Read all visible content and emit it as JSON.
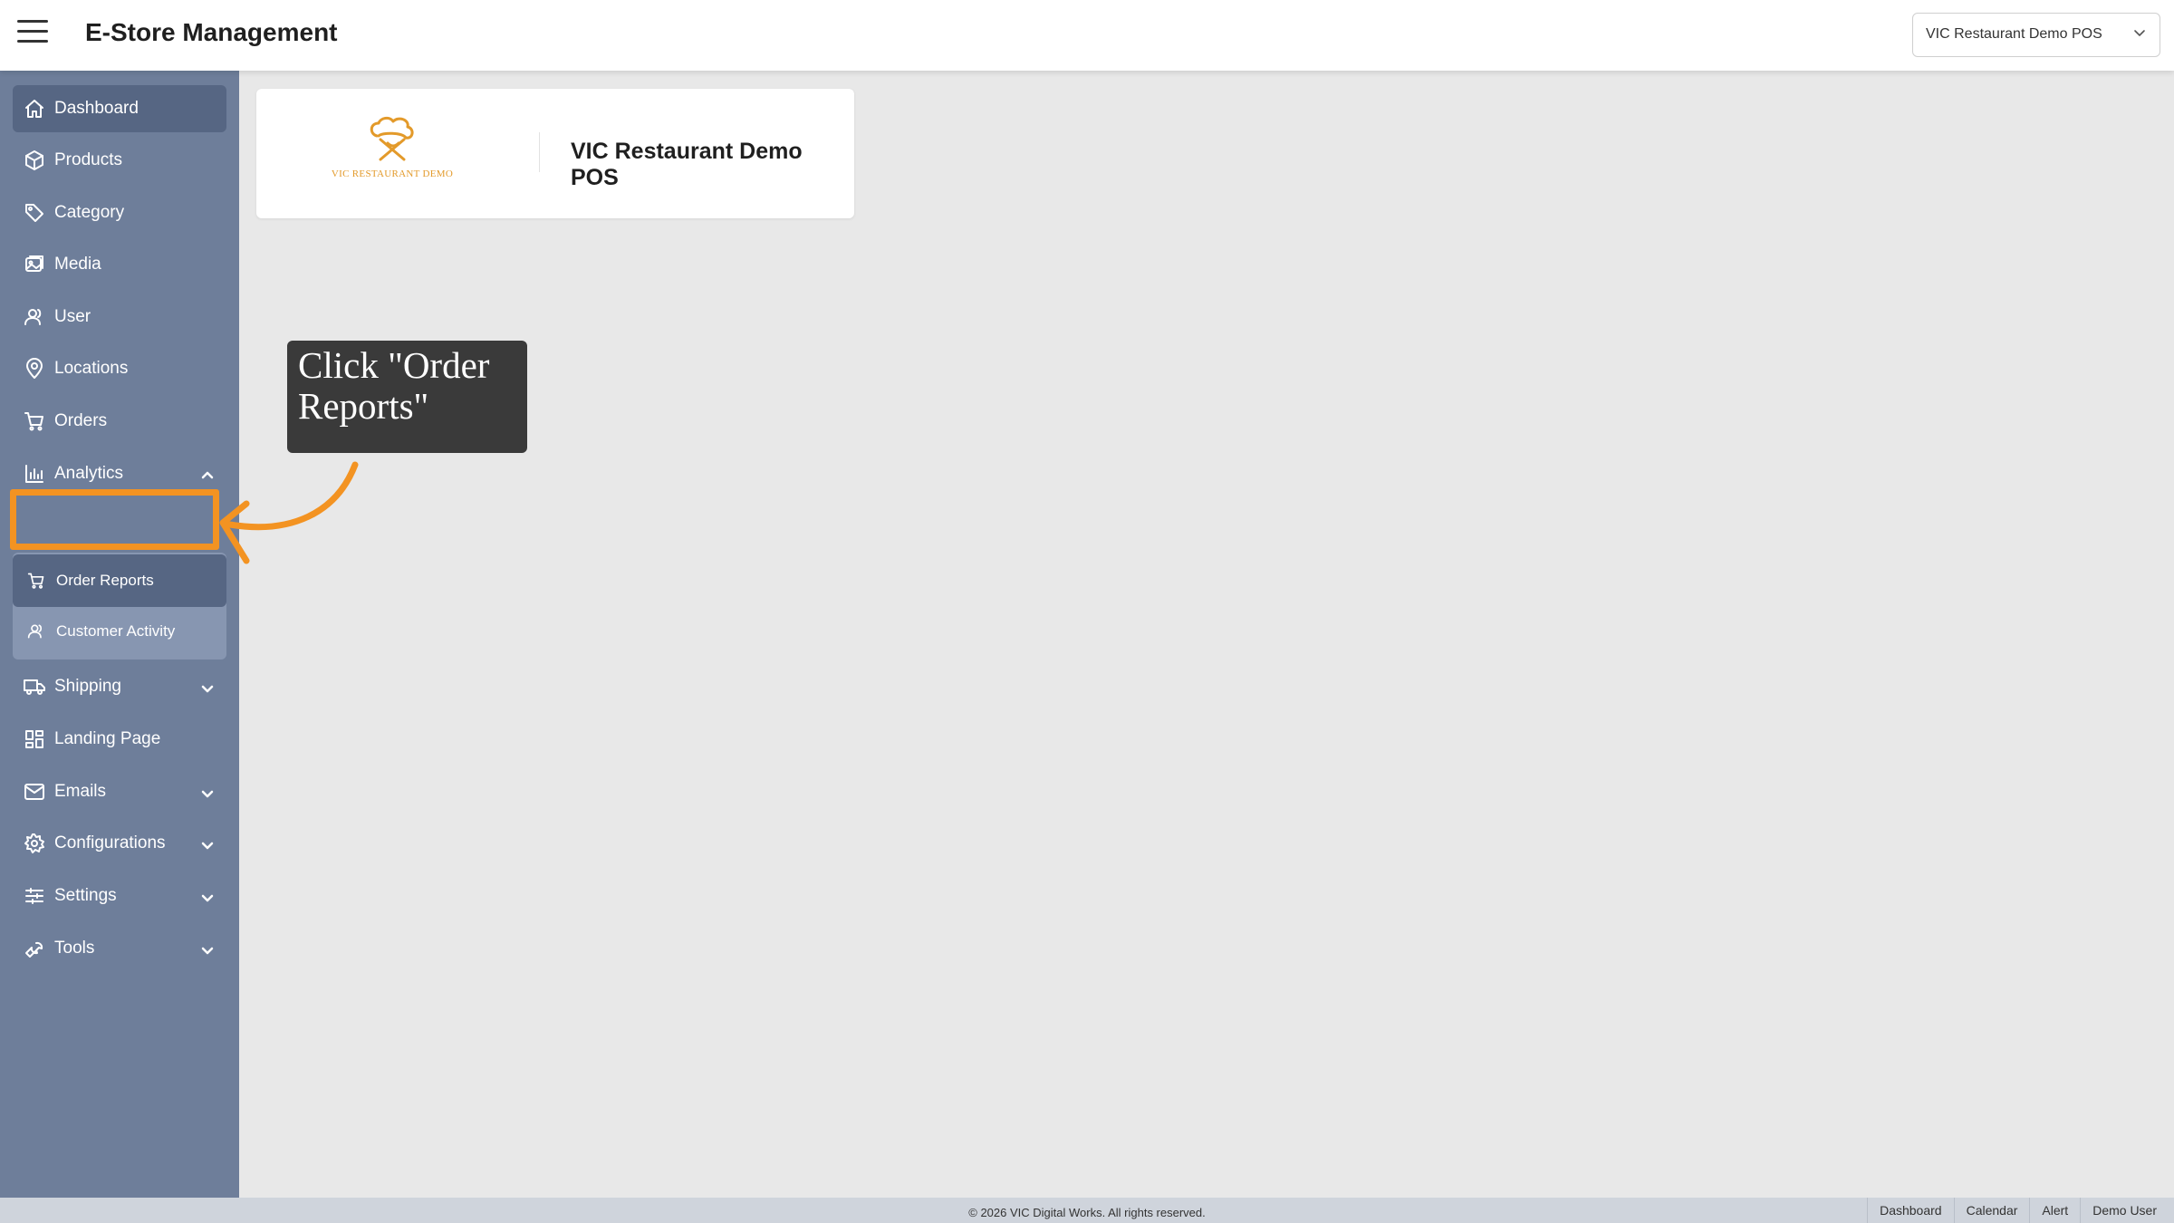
{
  "header": {
    "menu_icon": "hamburger-icon",
    "title": "E-Store Management",
    "store_selector": {
      "value": "VIC Restaurant Demo POS",
      "icon": "chevron-down-icon"
    }
  },
  "sidebar": {
    "items": [
      {
        "label": "Dashboard",
        "icon": "home-icon",
        "active": true
      },
      {
        "label": "Products",
        "icon": "box-icon"
      },
      {
        "label": "Category",
        "icon": "tag-icon"
      },
      {
        "label": "Media",
        "icon": "images-icon"
      },
      {
        "label": "User",
        "icon": "users-icon"
      },
      {
        "label": "Locations",
        "icon": "map-pin-icon"
      },
      {
        "label": "Orders",
        "icon": "cart-icon"
      },
      {
        "label": "Analytics",
        "icon": "bar-chart-icon",
        "expanded": true,
        "children": [
          {
            "label": "Order Reports",
            "icon": "cart-icon"
          },
          {
            "label": "Customer Activity",
            "icon": "users-icon"
          }
        ]
      },
      {
        "label": "Shipping",
        "icon": "truck-icon"
      },
      {
        "label": "Landing Page",
        "icon": "layout-grid-icon"
      },
      {
        "label": "Emails",
        "icon": "mail-icon"
      },
      {
        "label": "Configurations",
        "icon": "gear-icon"
      },
      {
        "label": "Settings",
        "icon": "sliders-icon"
      },
      {
        "label": "Tools",
        "icon": "wrench-icon"
      }
    ]
  },
  "store_card": {
    "logo_text": "VIC RESTAURANT DEMO",
    "store_name": "VIC Restaurant Demo POS"
  },
  "tutorial": {
    "callout_text": "Click \"Order Reports\"",
    "accent_color": "#f39322"
  },
  "footer": {
    "copyright": "© 2026 VIC Digital Works. All rights reserved.",
    "links": [
      "Dashboard",
      "Calendar",
      "Alert",
      "Demo User"
    ]
  },
  "colors": {
    "sidebar_bg": "#6e7e9a",
    "sidebar_active": "#566683",
    "content_bg": "#e8e8e8"
  }
}
